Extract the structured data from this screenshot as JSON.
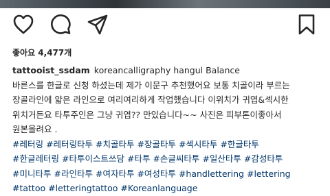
{
  "post": {
    "likes_text": "좋아요 4,477개",
    "username": "tattooist_ssdam",
    "caption_first": "koreancalligraphy hangul  Balance",
    "caption_lines": [
      "바른스를 한글로 신청 하셨는데 제가 이문구 추천했어요 보통 치골이라 부르는",
      "장골라인에 얇은 라인으로 여리여리하게 작업했습니다 이위치가 귀엽&섹시한",
      "위치거든요 타투주인은 그냥 귀엽?? 만있습니다~~ 사진은 피부톤이좋아서",
      "원본올려요 ."
    ],
    "hashtags": [
      [
        "#레터링",
        "#레터링타투",
        "#치골타투",
        "#장골타투",
        "#섹시타투",
        "#한글타투"
      ],
      [
        "#한글레터링",
        "#타투이스트쓰담",
        "#타투",
        "#손글씨타투",
        "#일산타투",
        "#감성타투"
      ],
      [
        "#미니타투",
        "#라인타투",
        "#여자타투",
        "#여성타투",
        "#handlettering",
        "#lettering"
      ],
      [
        "#tattoo",
        "#letteringtattoo",
        "#Koreanlanguage"
      ]
    ]
  },
  "icons": {
    "like": "heart-outline-icon",
    "comment": "comment-bubble-icon",
    "share": "paper-plane-icon",
    "save": "bookmark-icon"
  },
  "colors": {
    "text": "#262626",
    "hashtag": "#003569"
  }
}
